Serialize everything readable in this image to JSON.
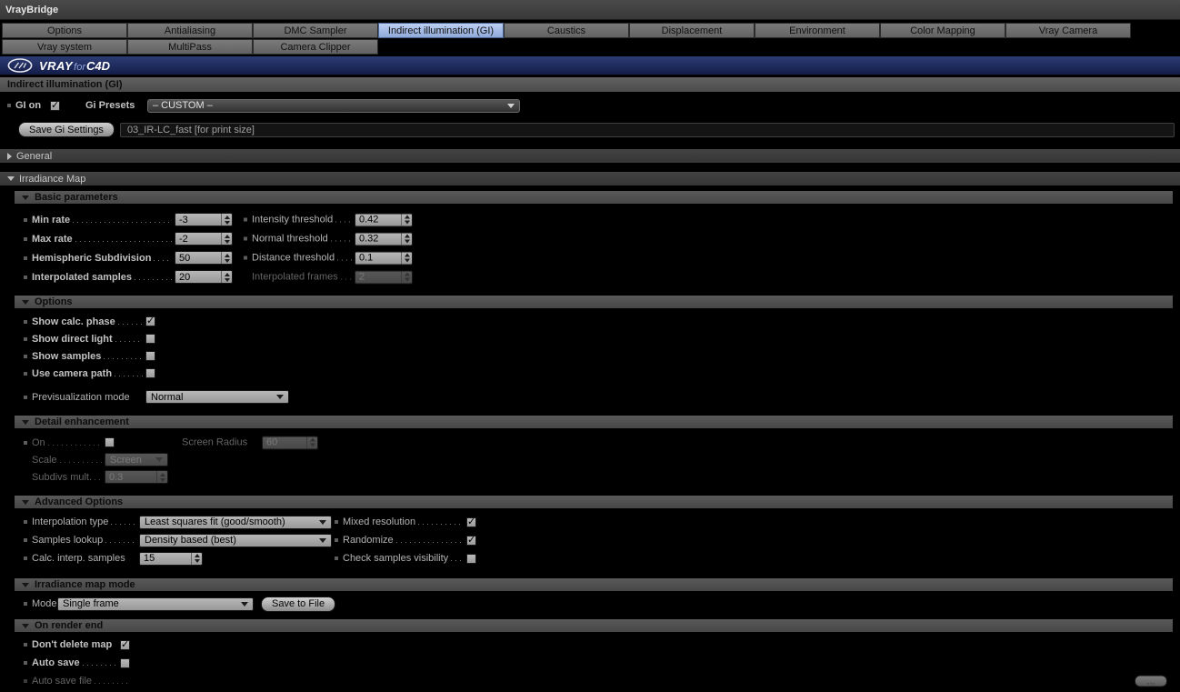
{
  "window": {
    "title": "VrayBridge"
  },
  "colors": {
    "selected_tab": "#a9bfe8",
    "banner": "#1e2a5c"
  },
  "tabs": {
    "row1": [
      "Options",
      "Antialiasing",
      "DMC Sampler",
      "Indirect illumination (GI)",
      "Caustics",
      "Displacement",
      "Environment",
      "Color Mapping",
      "Vray Camera"
    ],
    "row2": [
      "Vray system",
      "MultiPass",
      "Camera Clipper"
    ],
    "selected": "Indirect illumination (GI)"
  },
  "banner": {
    "vray": "VRAY",
    "for_text": "for",
    "c4d": "C4D"
  },
  "page": {
    "title": "Indirect illumination (GI)"
  },
  "gi": {
    "on_label": "GI on",
    "on_mark": "✓",
    "presets_label": "Gi Presets",
    "presets_value": "– CUSTOM –"
  },
  "save": {
    "button": "Save Gi Settings",
    "filename": "03_IR-LC_fast [for print size]"
  },
  "general": {
    "title": "General"
  },
  "irradiance": {
    "title": "Irradiance Map"
  },
  "basic": {
    "title": "Basic parameters",
    "rows": [
      {
        "l_label": "Min rate",
        "l_value": "-3",
        "r_label": "Intensity threshold",
        "r_value": "0.42"
      },
      {
        "l_label": "Max rate",
        "l_value": "-2",
        "r_label": "Normal threshold",
        "r_value": "0.32"
      },
      {
        "l_label": "Hemispheric Subdivision",
        "l_value": "50",
        "r_label": "Distance threshold",
        "r_value": "0.1"
      },
      {
        "l_label": "Interpolated samples",
        "l_value": "20",
        "r_label": "Interpolated frames",
        "r_value": "2"
      }
    ]
  },
  "options": {
    "title": "Options",
    "checks": [
      {
        "label": "Show calc. phase",
        "mark": "✓"
      },
      {
        "label": "Show direct light",
        "mark": ""
      },
      {
        "label": "Show samples",
        "mark": ""
      },
      {
        "label": "Use camera path",
        "mark": ""
      }
    ],
    "previs_label": "Previsualization mode",
    "previs_value": "Normal"
  },
  "detail": {
    "title": "Detail enhancement",
    "on_label": "On",
    "on_mark": "",
    "screen_radius_label": "Screen Radius",
    "screen_radius_value": "60",
    "scale_label": "Scale",
    "scale_value": "Screen",
    "subdivs_label": "Subdivs mult.",
    "subdivs_value": "0.3"
  },
  "advanced": {
    "title": "Advanced Options",
    "interp_type_label": "Interpolation type",
    "interp_type_value": "Least squares fit (good/smooth)",
    "mixed_label": "Mixed resolution",
    "mixed_mark": "✓",
    "samples_lookup_label": "Samples lookup",
    "samples_lookup_value": "Density based (best)",
    "randomize_label": "Randomize",
    "randomize_mark": "✓",
    "calc_samples_label": "Calc. interp. samples",
    "calc_samples_value": "15",
    "check_vis_label": "Check samples visibility",
    "check_vis_mark": ""
  },
  "map_mode": {
    "title": "Irradiance map mode",
    "mode_label": "Mode",
    "mode_value": "Single frame",
    "save_button": "Save to File"
  },
  "render_end": {
    "title": "On render end",
    "dont_delete_label": "Don't delete map",
    "dont_delete_mark": "✓",
    "auto_save_label": "Auto save",
    "auto_save_mark": "",
    "auto_save_file_label": "Auto save file",
    "browse_button": "..."
  }
}
